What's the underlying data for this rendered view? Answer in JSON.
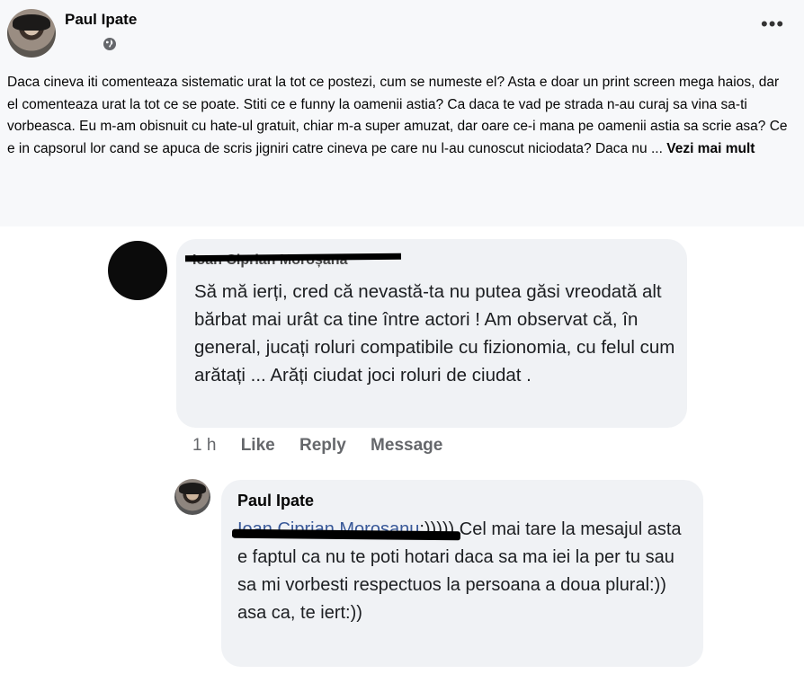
{
  "post": {
    "author": "Paul Ipate",
    "text": "Daca cineva iti comenteaza sistematic urat la tot ce postezi, cum se numeste el? Asta e doar un print screen mega haios, dar el comenteaza urat la tot ce se poate. Stiti ce e funny la oamenii astia? Ca daca te vad pe strada n-au curaj sa vina sa-ti vorbeasca. Eu m-am obisnuit cu hate-ul gratuit, chiar m-a super amuzat, dar oare ce-i mana pe oamenii astia sa scrie asa? Ce e in capsorul lor cand se apuca de scris jigniri catre cineva pe care nu l-au cunoscut niciodata? Daca nu ... ",
    "see_more": "Vezi mai mult",
    "privacy_icon": "globe-icon",
    "more_icon": "more-options-icon"
  },
  "comment1": {
    "author": "Ioan Ciprian Moroșana",
    "text": "Să mă ierți, cred că nevastă-ta nu putea găsi vreodată alt bărbat mai urât ca tine între actori ! Am observat că, în general, jucați roluri compatibile cu fizionomia, cu felul cum arătați ... Arăți ciudat joci roluri de ciudat .",
    "time": "1 h",
    "like": "Like",
    "reply": "Reply",
    "message": "Message"
  },
  "comment2": {
    "author": "Paul Ipate",
    "mention": "Ioan Ciprian Moroșanu",
    "text": ":))))) Cel mai tare la mesajul asta e faptul ca nu te poti hotari daca sa ma iei la per tu sau sa mi vorbesti respectuos la persoana a doua plural:)) asa ca, te iert:))"
  }
}
